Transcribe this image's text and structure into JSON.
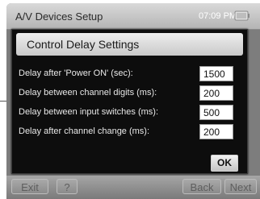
{
  "app": {
    "title": "A/V Devices Setup",
    "time": "07:09 PM",
    "buttons": {
      "exit": "Exit",
      "help": "?",
      "back": "Back",
      "next": "Next"
    }
  },
  "dialog": {
    "title": "Control Delay Settings",
    "settings": [
      {
        "label": "Delay after 'Power ON' (sec):",
        "value": "1500"
      },
      {
        "label": "Delay between channel digits (ms):",
        "value": "200"
      },
      {
        "label": "Delay between input switches (ms):",
        "value": "500"
      },
      {
        "label": "Delay after channel change (ms):",
        "value": "200"
      }
    ],
    "ok_label": "OK"
  },
  "icons": {
    "battery": "battery-icon"
  },
  "colors": {
    "dialog_background": "#0d0d0d",
    "window_background": "#7d7d7d",
    "label_text": "#e8e8e8"
  }
}
